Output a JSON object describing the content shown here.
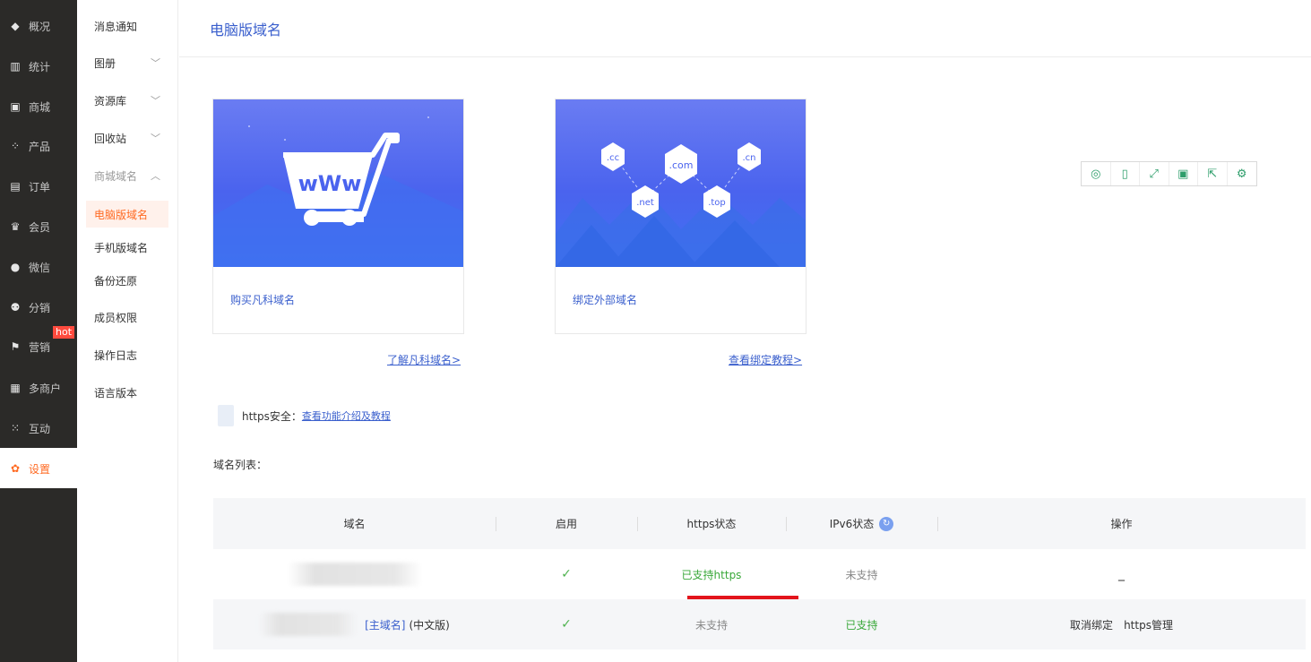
{
  "nav": {
    "items": [
      {
        "label": "概况",
        "icon": "layers-icon"
      },
      {
        "label": "统计",
        "icon": "chart-icon"
      },
      {
        "label": "商城",
        "icon": "store-icon"
      },
      {
        "label": "产品",
        "icon": "grid-icon"
      },
      {
        "label": "订单",
        "icon": "clipboard-icon"
      },
      {
        "label": "会员",
        "icon": "crown-icon"
      },
      {
        "label": "微信",
        "icon": "wechat-icon"
      },
      {
        "label": "分销",
        "icon": "users-icon"
      },
      {
        "label": "营销",
        "icon": "flag-icon"
      },
      {
        "label": "多商户",
        "icon": "shop-icon"
      },
      {
        "label": "互动",
        "icon": "apps-icon"
      },
      {
        "label": "设置",
        "icon": "gear-icon"
      }
    ],
    "hot_badge": "hot"
  },
  "subnav": {
    "items": [
      {
        "label": "消息通知"
      },
      {
        "label": "图册"
      },
      {
        "label": "资源库"
      },
      {
        "label": "回收站"
      },
      {
        "label": "商城域名"
      },
      {
        "label": "电脑版域名"
      },
      {
        "label": "手机版域名"
      },
      {
        "label": "备份还原"
      },
      {
        "label": "成员权限"
      },
      {
        "label": "操作日志"
      },
      {
        "label": "语言版本"
      }
    ]
  },
  "page": {
    "title": "电脑版域名"
  },
  "cards": [
    {
      "caption": "购买凡科域名",
      "link": "了解凡科域名>",
      "banner_text": "wWw"
    },
    {
      "caption": "绑定外部域名",
      "link": "查看绑定教程>",
      "tlds": [
        ".cc",
        ".com",
        ".cn",
        ".net",
        ".top"
      ]
    }
  ],
  "https": {
    "label": "https安全：",
    "link": "查看功能介绍及教程"
  },
  "list": {
    "title": "域名列表：",
    "columns": [
      "域名",
      "启用",
      "https状态",
      "IPv6状态",
      "操作"
    ],
    "rows": [
      {
        "domain_tag": "",
        "enabled": "✓",
        "https": "已支持https",
        "ipv6": "未支持",
        "action": "_"
      },
      {
        "domain_tag": "[主域名]",
        "domain_suffix": "(中文版)",
        "enabled": "✓",
        "https": "未支持",
        "ipv6": "已支持",
        "action_unbind": "取消绑定",
        "action_https": "https管理"
      }
    ]
  },
  "colors": {
    "accent": "#ff6a22",
    "link": "#3a5fcd",
    "success": "#3aa83a",
    "highlight": "#e3141c"
  }
}
